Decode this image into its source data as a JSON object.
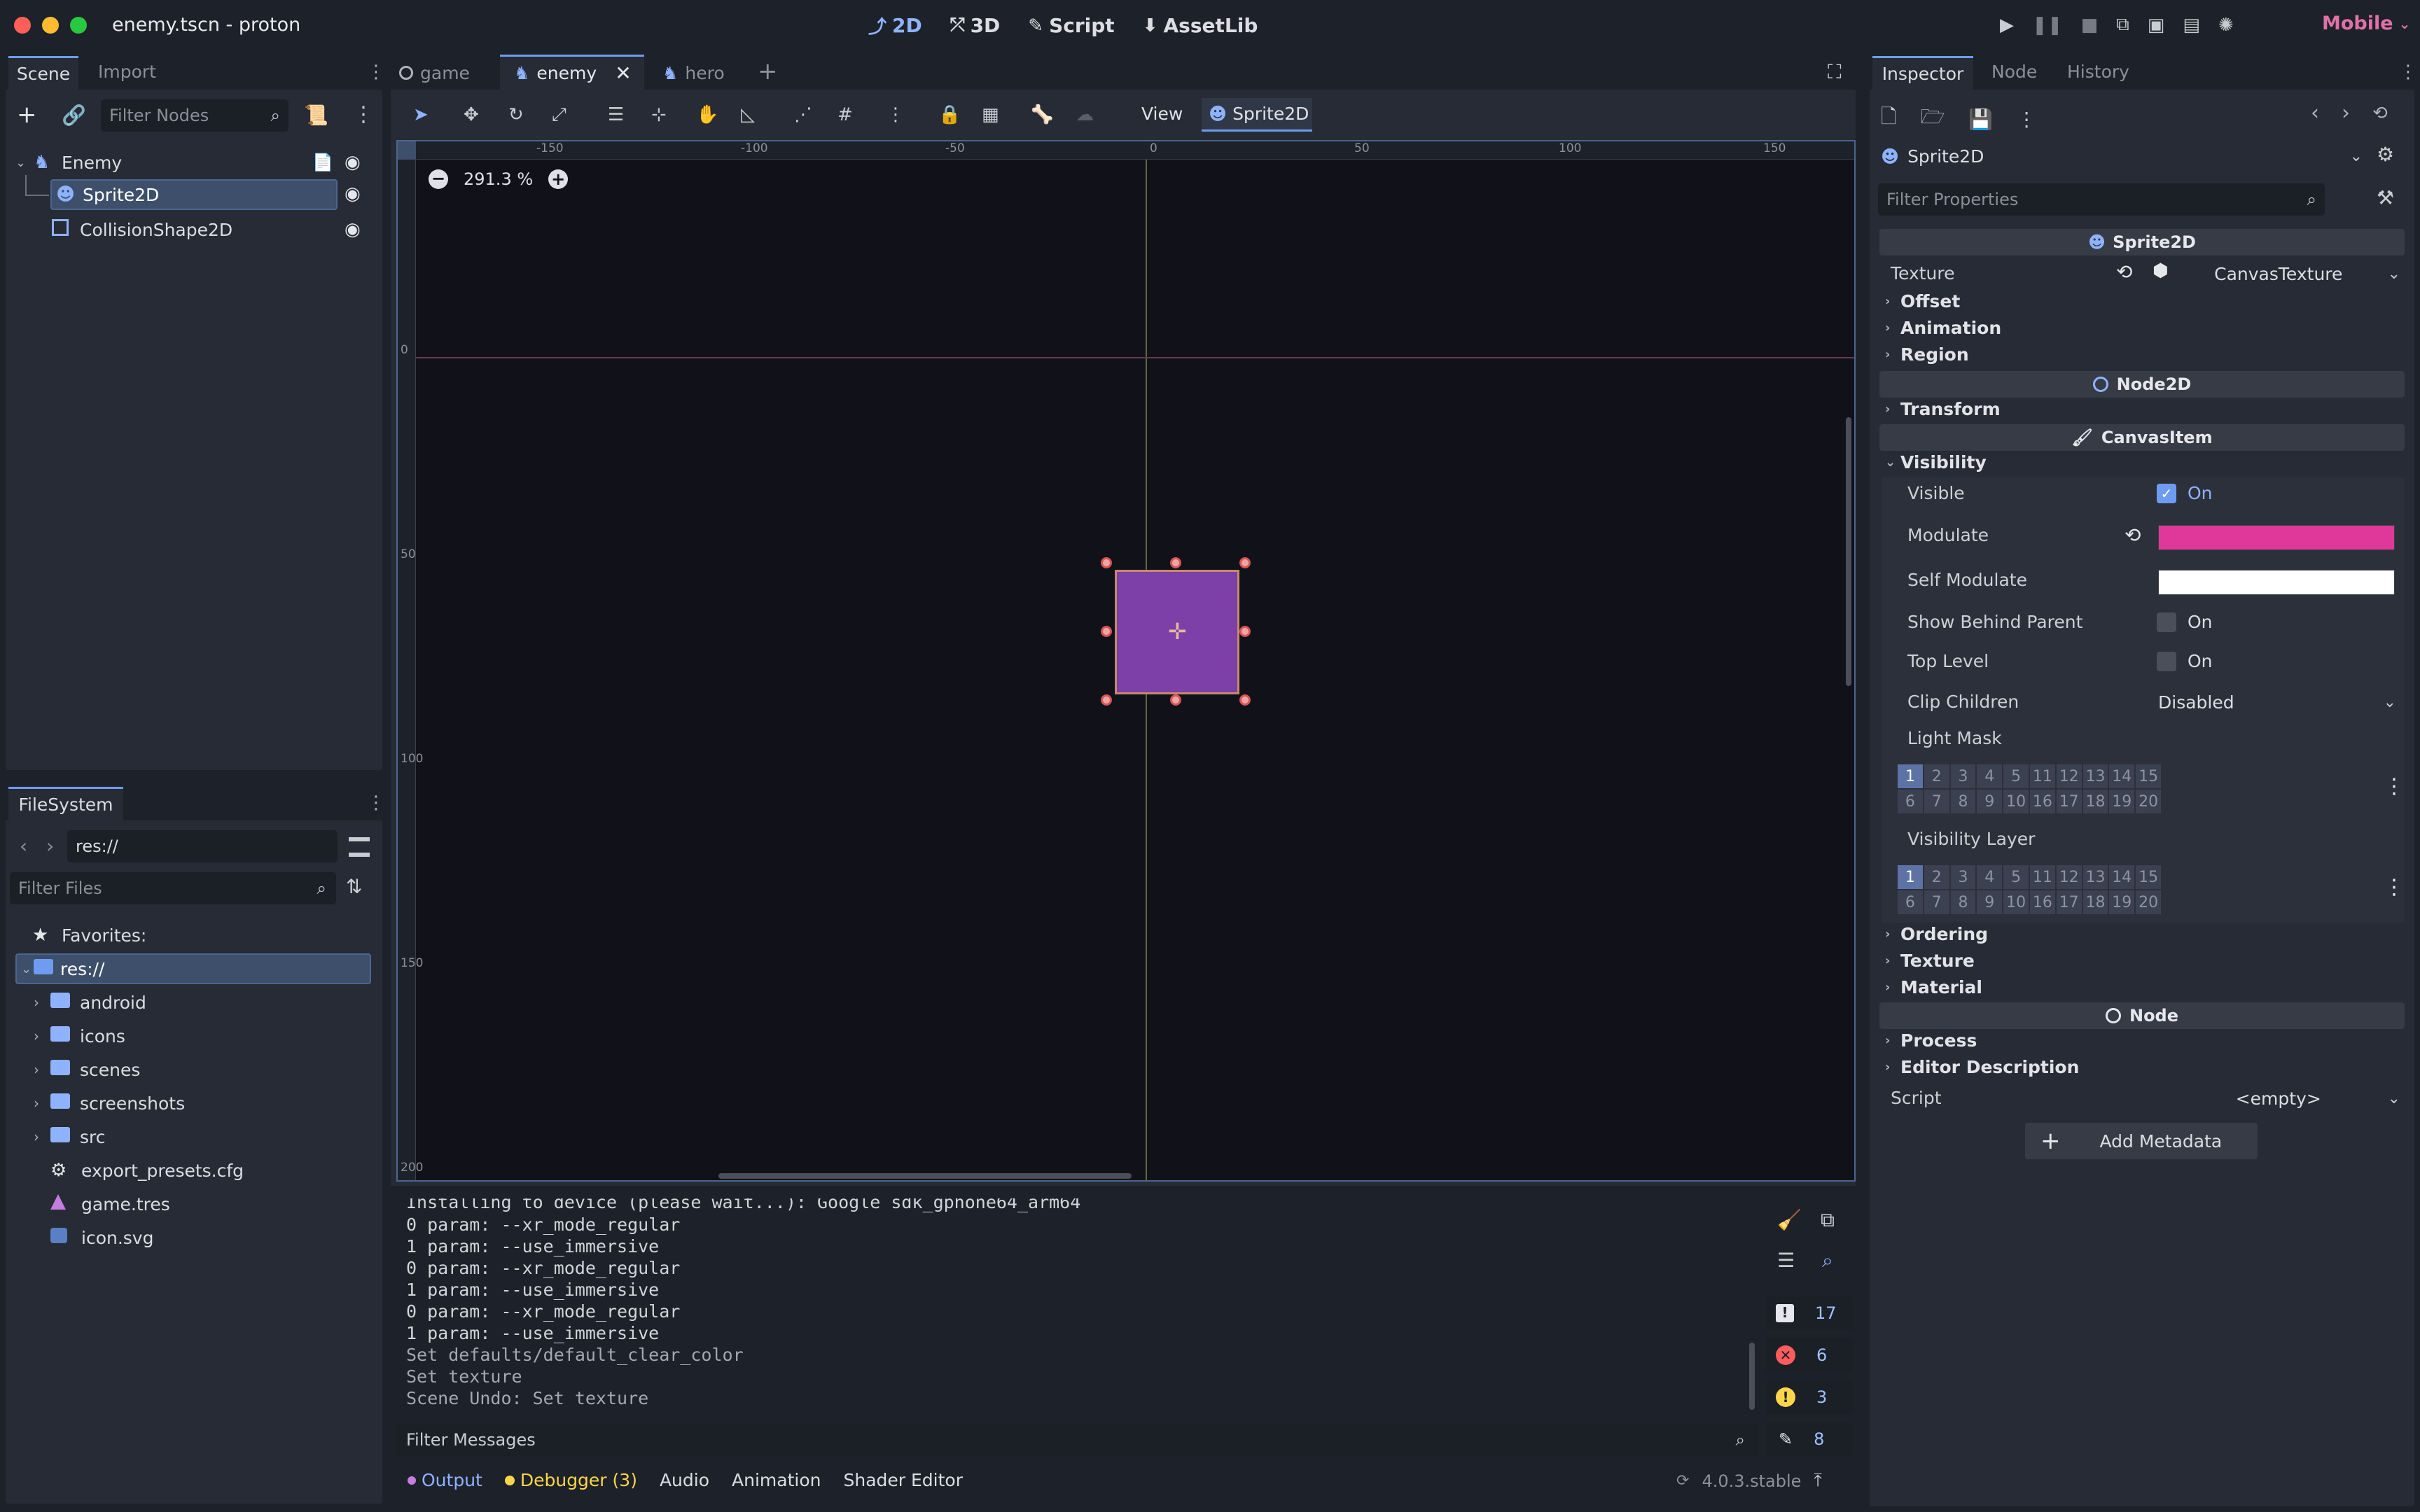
{
  "window": {
    "title": "enemy.tscn - proton"
  },
  "main_modes": [
    {
      "label": "2D",
      "icon": "2d-icon"
    },
    {
      "label": "3D",
      "icon": "3d-icon"
    },
    {
      "label": "Script",
      "icon": "script-icon"
    },
    {
      "label": "AssetLib",
      "icon": "assetlib-icon"
    }
  ],
  "renderer": "Mobile",
  "scene_dock": {
    "tabs": [
      "Scene",
      "Import"
    ],
    "filter_placeholder": "Filter Nodes",
    "nodes": [
      {
        "label": "Enemy",
        "icon": "character-icon"
      },
      {
        "label": "Sprite2D",
        "icon": "sprite-icon"
      },
      {
        "label": "CollisionShape2D",
        "icon": "collision-shape-icon"
      }
    ]
  },
  "filesystem": {
    "tab": "FileSystem",
    "path": "res://",
    "filter_placeholder": "Filter Files",
    "favorites": "Favorites:",
    "root": "res://",
    "items": [
      {
        "label": "android",
        "icon": "folder-icon"
      },
      {
        "label": "icons",
        "icon": "folder-icon"
      },
      {
        "label": "scenes",
        "icon": "folder-icon"
      },
      {
        "label": "screenshots",
        "icon": "folder-icon"
      },
      {
        "label": "src",
        "icon": "folder-icon"
      },
      {
        "label": "export_presets.cfg",
        "icon": "gear-file-icon"
      },
      {
        "label": "game.tres",
        "icon": "resource-icon"
      },
      {
        "label": "icon.svg",
        "icon": "image-icon"
      }
    ]
  },
  "editor_tabs": [
    {
      "label": "game",
      "active": false
    },
    {
      "label": "enemy",
      "active": true
    },
    {
      "label": "hero",
      "active": false
    }
  ],
  "viewport_toolbar": {
    "view_label": "View",
    "node_label": "Sprite2D"
  },
  "viewport": {
    "zoom": "291.3 %",
    "ruler_top": [
      "-150",
      "-100",
      "-50",
      "0",
      "50",
      "100",
      "150"
    ],
    "ruler_left": [
      "0",
      "50",
      "100",
      "150",
      "200"
    ],
    "sprite_color": "#7d3fa8"
  },
  "output": {
    "lines": [
      "Installing to device (please wait...): Google sdk_gphone64_arm64",
      "0 param: --xr_mode_regular",
      "1 param: --use_immersive",
      "0 param: --xr_mode_regular",
      "1 param: --use_immersive",
      "0 param: --xr_mode_regular",
      "1 param: --use_immersive",
      "Set defaults/default_clear_color",
      "Set texture",
      "Scene Undo: Set texture"
    ],
    "filter_placeholder": "Filter Messages",
    "counts": {
      "messages": "17",
      "errors": "6",
      "warnings": "3",
      "editor": "8"
    }
  },
  "bottom_tabs": [
    "Output",
    "Debugger (3)",
    "Audio",
    "Animation",
    "Shader Editor"
  ],
  "version": "4.0.3.stable",
  "inspector": {
    "tabs": [
      "Inspector",
      "Node",
      "History"
    ],
    "object": "Sprite2D",
    "filter_placeholder": "Filter Properties",
    "sections": {
      "sprite": "Sprite2D",
      "node2d": "Node2D",
      "canvasitem": "CanvasItem",
      "node": "Node"
    },
    "texture_label": "Texture",
    "texture_value": "CanvasTexture",
    "categories": {
      "offset": "Offset",
      "animation": "Animation",
      "region": "Region",
      "transform": "Transform",
      "visibility": "Visibility",
      "ordering": "Ordering",
      "texture": "Texture",
      "material": "Material",
      "process": "Process",
      "editor_description": "Editor Description"
    },
    "props": {
      "visible": "Visible",
      "visible_val": "On",
      "modulate": "Modulate",
      "modulate_color": "#e0389a",
      "self_modulate": "Self Modulate",
      "self_modulate_color": "#ffffff",
      "show_behind": "Show Behind Parent",
      "show_behind_val": "On",
      "top_level": "Top Level",
      "top_level_val": "On",
      "clip_children": "Clip Children",
      "clip_children_val": "Disabled",
      "light_mask": "Light Mask",
      "visibility_layer": "Visibility Layer",
      "script": "Script",
      "script_val": "<empty>"
    },
    "layers_row1": [
      "1",
      "2",
      "3",
      "4",
      "5",
      "11",
      "12",
      "13",
      "14",
      "15"
    ],
    "layers_row2": [
      "6",
      "7",
      "8",
      "9",
      "10",
      "16",
      "17",
      "18",
      "19",
      "20"
    ],
    "add_metadata": "Add Metadata"
  }
}
